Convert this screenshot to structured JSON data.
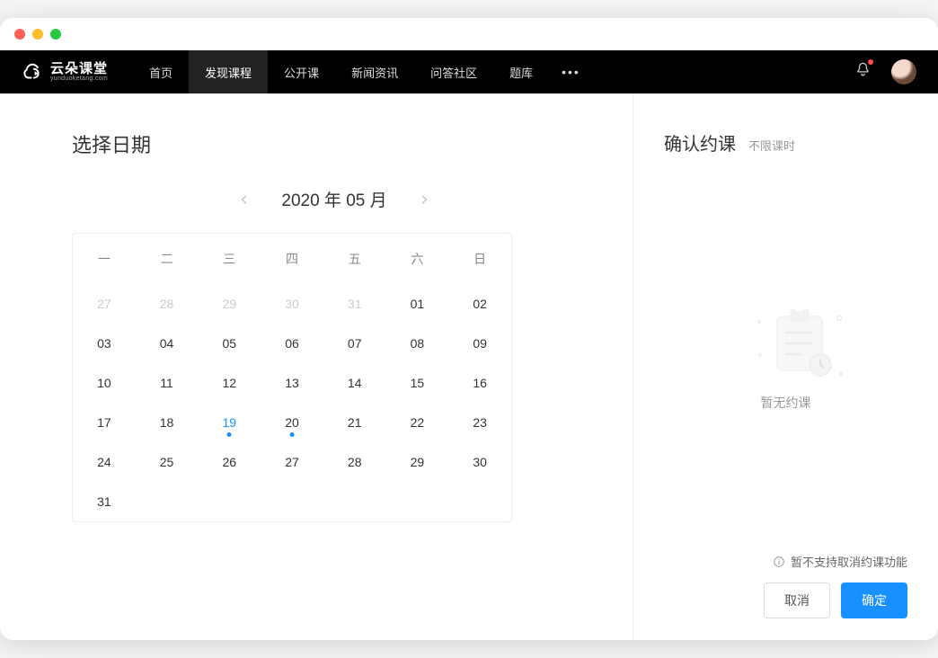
{
  "logo": {
    "main": "云朵课堂",
    "sub": "yunduoketang.com"
  },
  "nav": {
    "items": [
      "首页",
      "发现课程",
      "公开课",
      "新闻资讯",
      "问答社区",
      "题库"
    ],
    "activeIndex": 1
  },
  "left": {
    "title": "选择日期",
    "month_label": "2020 年 05 月",
    "weekdays": [
      "一",
      "二",
      "三",
      "四",
      "五",
      "六",
      "日"
    ],
    "cells": [
      {
        "t": "27",
        "dim": true
      },
      {
        "t": "28",
        "dim": true
      },
      {
        "t": "29",
        "dim": true
      },
      {
        "t": "30",
        "dim": true
      },
      {
        "t": "31",
        "dim": true
      },
      {
        "t": "01"
      },
      {
        "t": "02"
      },
      {
        "t": "03"
      },
      {
        "t": "04"
      },
      {
        "t": "05"
      },
      {
        "t": "06"
      },
      {
        "t": "07"
      },
      {
        "t": "08"
      },
      {
        "t": "09"
      },
      {
        "t": "10"
      },
      {
        "t": "11"
      },
      {
        "t": "12"
      },
      {
        "t": "13"
      },
      {
        "t": "14"
      },
      {
        "t": "15"
      },
      {
        "t": "16"
      },
      {
        "t": "17"
      },
      {
        "t": "18"
      },
      {
        "t": "19",
        "today": true,
        "point": true
      },
      {
        "t": "20",
        "point": true
      },
      {
        "t": "21"
      },
      {
        "t": "22"
      },
      {
        "t": "23"
      },
      {
        "t": "24"
      },
      {
        "t": "25"
      },
      {
        "t": "26"
      },
      {
        "t": "27"
      },
      {
        "t": "28"
      },
      {
        "t": "29"
      },
      {
        "t": "30"
      },
      {
        "t": "31"
      }
    ]
  },
  "right": {
    "title": "确认约课",
    "subtitle": "不限课时",
    "empty_text": "暂无约课",
    "note": "暂不支持取消约课功能",
    "cancel": "取消",
    "confirm": "确定"
  }
}
